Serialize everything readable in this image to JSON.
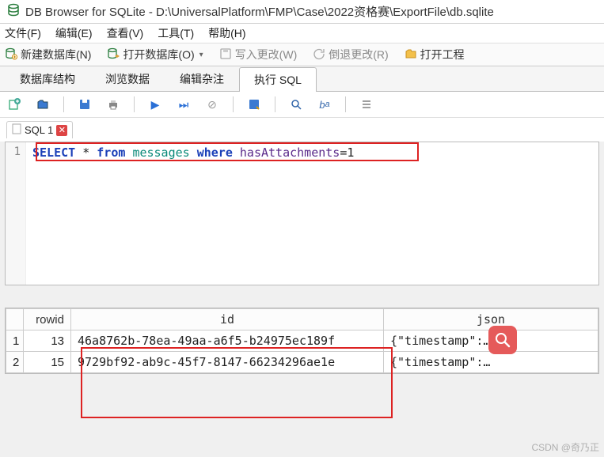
{
  "window": {
    "title": "DB Browser for SQLite - D:\\UniversalPlatform\\FMP\\Case\\2022资格赛\\ExportFile\\db.sqlite"
  },
  "menubar": {
    "file": "文件(F)",
    "edit": "编辑(E)",
    "view": "查看(V)",
    "tools": "工具(T)",
    "help": "帮助(H)"
  },
  "toolbar": {
    "new_db": "新建数据库(N)",
    "open_db": "打开数据库(O)",
    "write_changes": "写入更改(W)",
    "revert_changes": "倒退更改(R)",
    "open_project": "打开工程"
  },
  "tabs": {
    "structure": "数据库结构",
    "browse": "浏览数据",
    "pragmas": "编辑杂注",
    "execute": "执行 SQL"
  },
  "sql": {
    "tab_label": "SQL 1",
    "line_number": "1",
    "tokens": {
      "select": "SELECT",
      "star": "*",
      "from": "from",
      "table": "messages",
      "where": "where",
      "condition_left": "hasAttachments",
      "condition_right": "=1"
    }
  },
  "results": {
    "columns": {
      "rowid": "rowid",
      "id": "id",
      "json": "json"
    },
    "rows": [
      {
        "num": "1",
        "rowid": "13",
        "id": "46a8762b-78ea-49aa-a6f5-b24975ec189f",
        "json": "{\"timestamp\":…"
      },
      {
        "num": "2",
        "rowid": "15",
        "id": "9729bf92-ab9c-45f7-8147-66234296ae1e",
        "json": "{\"timestamp\":…"
      }
    ]
  },
  "watermark": "CSDN @奇乃正"
}
